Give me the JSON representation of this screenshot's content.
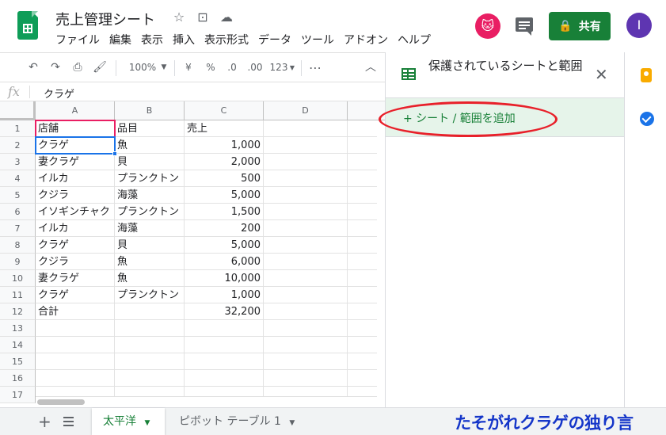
{
  "header": {
    "doc_title": "売上管理シート",
    "title_icons": [
      "star-icon",
      "move-folder-icon",
      "cloud-status-icon"
    ],
    "menu": [
      "ファイル",
      "編集",
      "表示",
      "挿入",
      "表示形式",
      "データ",
      "ツール",
      "アドオン",
      "ヘルプ"
    ],
    "share_label": "共有",
    "user_initial": "I",
    "brand_color": "#0f9d58",
    "share_color": "#188038",
    "avatar_color": "#5e35b1"
  },
  "toolbar": {
    "zoom": "100%",
    "currency": "¥",
    "percent": "%",
    "decrease_decimal": ".0",
    "increase_decimal": ".00",
    "format": "123",
    "more": "⋯"
  },
  "formula_bar": {
    "fx": "fx",
    "value": "クラゲ"
  },
  "columns": [
    "A",
    "B",
    "C",
    "D"
  ],
  "rows": [
    {
      "n": "1",
      "a": "店舗",
      "b": "品目",
      "c": "売上"
    },
    {
      "n": "2",
      "a": "クラゲ",
      "b": "魚",
      "c": "1,000"
    },
    {
      "n": "3",
      "a": "妻クラゲ",
      "b": "貝",
      "c": "2,000"
    },
    {
      "n": "4",
      "a": "イルカ",
      "b": "プランクトン",
      "c": "500"
    },
    {
      "n": "5",
      "a": "クジラ",
      "b": "海藻",
      "c": "5,000"
    },
    {
      "n": "6",
      "a": "イソギンチャク",
      "b": "プランクトン",
      "c": "1,500"
    },
    {
      "n": "7",
      "a": "イルカ",
      "b": "海藻",
      "c": "200"
    },
    {
      "n": "8",
      "a": "クラゲ",
      "b": "貝",
      "c": "5,000"
    },
    {
      "n": "9",
      "a": "クジラ",
      "b": "魚",
      "c": "6,000"
    },
    {
      "n": "10",
      "a": "妻クラゲ",
      "b": "魚",
      "c": "10,000"
    },
    {
      "n": "11",
      "a": "クラゲ",
      "b": "プランクトン",
      "c": "1,000"
    },
    {
      "n": "12",
      "a": "合計",
      "b": "",
      "c": "32,200"
    },
    {
      "n": "13",
      "a": "",
      "b": "",
      "c": ""
    },
    {
      "n": "14",
      "a": "",
      "b": "",
      "c": ""
    },
    {
      "n": "15",
      "a": "",
      "b": "",
      "c": ""
    },
    {
      "n": "16",
      "a": "",
      "b": "",
      "c": ""
    },
    {
      "n": "17",
      "a": "",
      "b": "",
      "c": ""
    }
  ],
  "panel": {
    "title": "保護されているシートと範囲",
    "add_range": "+ シート / 範囲を追加",
    "highlight_color": "#e8202a"
  },
  "tabs": {
    "active": "太平洋",
    "inactive": "ピボット テーブル 1"
  },
  "watermark": "たそがれクラゲの独り言"
}
